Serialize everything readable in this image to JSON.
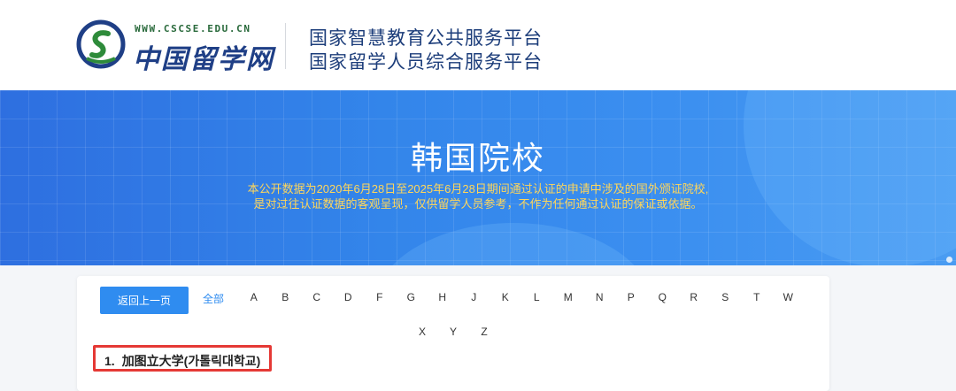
{
  "header": {
    "logo_url": "WWW.CSCSE.EDU.CN",
    "logo_name": "中国留学网",
    "platform_lines": [
      "国家智慧教育公共服务平台",
      "国家留学人员综合服务平台"
    ]
  },
  "banner": {
    "title": "韩国院校",
    "note_lines": [
      "本公开数据为2020年6月28日至2025年6月28日期间通过认证的申请中涉及的国外颁证院校,",
      "是对过往认证数据的客观呈现，仅供留学人员参考，不作为任何通过认证的保证或依据。"
    ]
  },
  "nav": {
    "back_label": "返回上一页",
    "all_label": "全部",
    "letters_row1": [
      "A",
      "B",
      "C",
      "D",
      "F",
      "G",
      "H",
      "J",
      "K",
      "L",
      "M",
      "N",
      "P",
      "Q",
      "R",
      "S",
      "T",
      "W"
    ],
    "letters_row2": [
      "X",
      "Y",
      "Z"
    ]
  },
  "entries": [
    {
      "number": "1.",
      "name": "加图立大学(가톨릭대학교)"
    }
  ],
  "colors": {
    "banner_blue": "#3385ea",
    "note_yellow": "#ffd65a",
    "button_blue": "#2f8cf0",
    "highlight_red": "#e53935"
  }
}
